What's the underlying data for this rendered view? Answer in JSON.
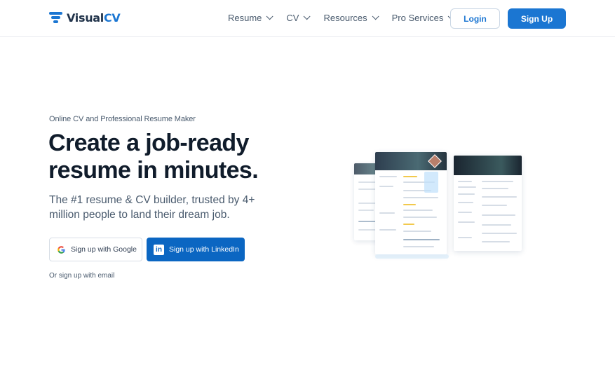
{
  "brand": {
    "part1": "Visual",
    "part2": "CV",
    "color": "#1b76d2"
  },
  "nav": {
    "items": [
      {
        "label": "Resume"
      },
      {
        "label": "CV"
      },
      {
        "label": "Resources"
      },
      {
        "label": "Pro Services"
      }
    ],
    "login_label": "Login",
    "signup_label": "Sign Up"
  },
  "hero": {
    "eyebrow": "Online CV and Professional Resume Maker",
    "headline": "Create a job-ready resume in minutes.",
    "subhead": "The #1 resume & CV builder, trusted by 4+ million people to land their dream job.",
    "google_label": "Sign up with Google",
    "linkedin_label": "Sign up with LinkedIn",
    "email_link": "Or sign up with email"
  },
  "colors": {
    "primary": "#1b76d2",
    "linkedin": "#0b66c2",
    "heading": "#101c2b",
    "body": "#4a5b6e"
  }
}
